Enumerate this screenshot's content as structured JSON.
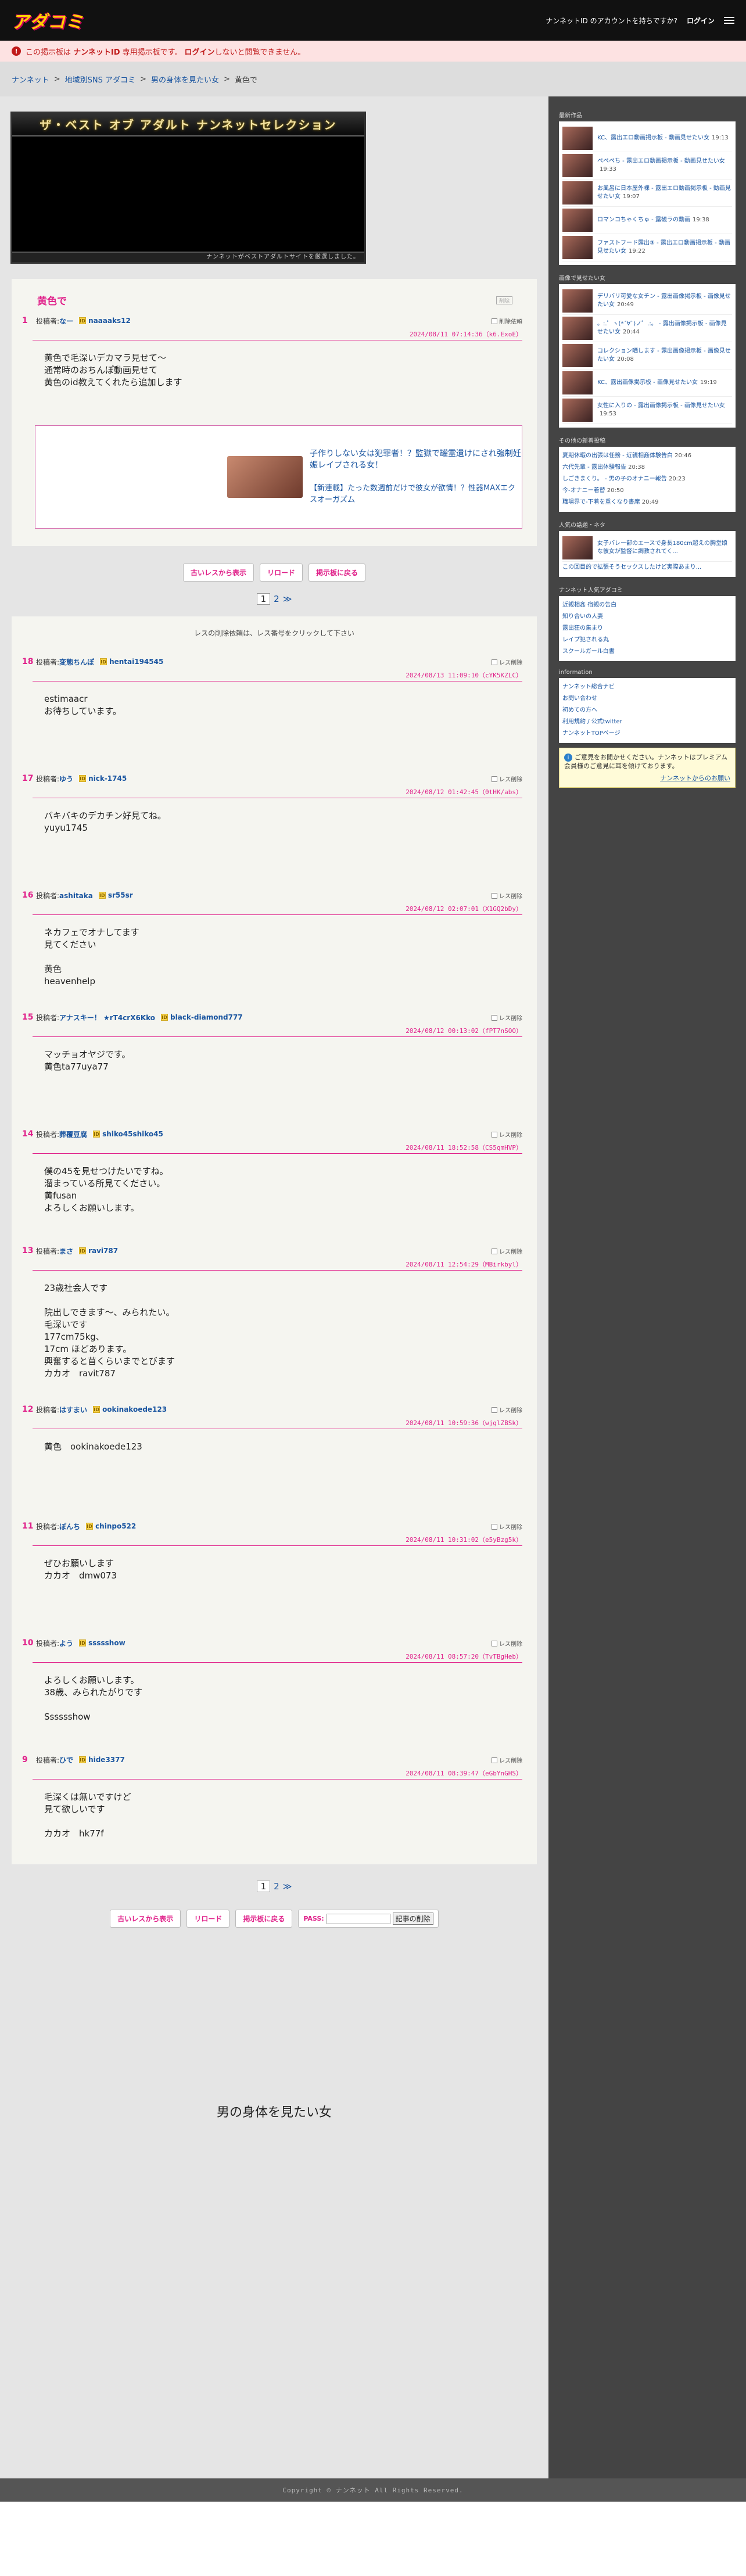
{
  "site": {
    "logo": "アダコミ",
    "no_account": "ナンネットID のアカウントを持ちですか?",
    "login": "ログイン"
  },
  "notice": {
    "icon": "!",
    "text1": "この掲示板は ",
    "id": "ナンネットID",
    "text2": " 専用掲示板です。 ",
    "login": "ログイン",
    "text3": "しないと閲覧できません。"
  },
  "breadcrumb": [
    "ナンネット",
    "地域別SNS アダコミ",
    "男の身体を見たい女",
    "黄色で"
  ],
  "banner": {
    "title": "ザ・ベスト オブ アダルト ナンネットセレクション",
    "footer": "ナンネットがベストアダルトサイトを厳選しました。"
  },
  "op": {
    "title": "黄色で",
    "remove_label": "削除",
    "num": "1",
    "by_label": "投稿者:",
    "name": "なー",
    "id": "naaaaks12",
    "date": "2024/08/11 07:14:36（k6.ExoE）",
    "body": "黄色で毛深いデカマラ見せて〜\n通常時のおちんぽ動画見せて\n黄色のid教えてくれたら追加します",
    "del": "削除依頼"
  },
  "ad": {
    "line1": "子作りしない女は犯罪者！？監獄で罐霊遺けにされ強制妊娠レイプされる女！",
    "line2": "【新連載】たった数週前だけで彼女が欲情！？性器MAXエクスオーガズム"
  },
  "buttons": {
    "old": "古いレスから表示",
    "reload": "リロード",
    "back": "掲示板に戻る",
    "pass": "PASS:",
    "delete": "記事の削除"
  },
  "pager": {
    "cur": "1",
    "next": "2",
    "arrow": "≫"
  },
  "reshint": "レスの削除依頼は、レス番号をクリックして下さい",
  "posts": [
    {
      "num": "18",
      "name": "変態ちんぽ",
      "id": "hentai194545",
      "date": "2024/08/13 11:09:10（cYK5KZLC）",
      "body": "estimaacr\nお待ちしています。"
    },
    {
      "num": "17",
      "name": "ゆう",
      "id": "nick-1745",
      "date": "2024/08/12 01:42:45（0tHK/abs）",
      "body": "バキバキのデカチン好見てね。\nyuyu1745"
    },
    {
      "num": "16",
      "name": "ashitaka",
      "id": "sr55sr",
      "date": "2024/08/12 02:07:01（X1GQ2bDy）",
      "body": "ネカフェでオナしてます\n見てください\n\n黄色\nheavenhelp"
    },
    {
      "num": "15",
      "name": "アナスキー！ ★rT4crX6Kko",
      "id": "black-diamond777",
      "date": "2024/08/12 00:13:02（fPT7nSOO）",
      "body": "マッチョオヤジです。\n黄色ta77uya77"
    },
    {
      "num": "14",
      "name": "葬覆豆腐",
      "id": "shiko45shiko45",
      "date": "2024/08/11 18:52:58（CS5qmHVP）",
      "body": "僕の45を見せつけたいですね。\n溜まっている所見てください。\n黄fusan\nよろしくお願いします。"
    },
    {
      "num": "13",
      "name": "まさ",
      "id": "ravi787",
      "date": "2024/08/11 12:54:29（MBirkbyl）",
      "body": "23歳社会人です\n\n院出しできます〜、みられたい。\n毛深いです\n177cm75kg、\n17cm ほどあります。\n興奮すると苜くらいまでとびます\nカカオ　ravit787"
    },
    {
      "num": "12",
      "name": "はすまい",
      "id": "ookinakoede123",
      "date": "2024/08/11 10:59:36（wjglZBSk）",
      "body": "黄色　ookinakoede123"
    },
    {
      "num": "11",
      "name": "ぽんち",
      "id": "chinpo522",
      "date": "2024/08/11 10:31:02（e5yBzg5k）",
      "body": "ぜひお願いします\nカカオ　dmw073"
    },
    {
      "num": "10",
      "name": "よう",
      "id": "ssssshow",
      "date": "2024/08/11 08:57:20（TvTBgHeb）",
      "body": "よろしくお願いします。\n38歳、みられたがりです\n\nSssssshow"
    },
    {
      "num": "9",
      "name": "ひで",
      "id": "hide3377",
      "date": "2024/08/11 08:39:47（eGbYnGHS）",
      "body": "毛深くは無いですけど\n見て欲しいです\n\nカカオ　hk77f"
    }
  ],
  "post_label": "投稿者:",
  "del_label": "レス削除",
  "pagetitle": "男の身体を見たい女",
  "footer": "Copyright © ナンネット All Rights Reserved.",
  "sidebar": {
    "s1": {
      "title": "最新作品",
      "items": [
        {
          "t": "KC、露出エロ動画掲示板 - 動画見せたい女",
          "tm": "19:13"
        },
        {
          "t": "ペペペち - 露出エロ動画掲示板 - 動画見せたい女",
          "tm": "19:33"
        },
        {
          "t": "お風呂に日本屋外裸 - 露出エロ動画掲示板 - 動画見せたい女",
          "tm": "19:07"
        },
        {
          "t": "ロマンコちゃくちゅ - 露観ラの動画",
          "tm": "19:38"
        },
        {
          "t": "ファストフード露出③ - 露出エロ動画掲示板 - 動画見せたい女",
          "tm": "19:22"
        }
      ]
    },
    "s2": {
      "title": "画像で見せたい女",
      "items": [
        {
          "t": "デリバリ可愛な女チン - 露出画像掲示板 - 画像見せたい女",
          "tm": "20:49"
        },
        {
          "t": "。:.゜ヽ(*´∀`)ノ゜.:。 - 露出画像掲示板 - 画像見せたい女",
          "tm": "20:44"
        },
        {
          "t": "コレクション晒します - 露出画像掲示板 - 画像見せたい女",
          "tm": "20:08"
        },
        {
          "t": "KC、露出画像掲示板 - 画像見せたい女",
          "tm": "19:19"
        },
        {
          "t": "女性に入りの - 露出画像掲示板 - 画像見せたい女",
          "tm": "19:53"
        }
      ]
    },
    "s3": {
      "title": "その他の新着投稿",
      "links": [
        {
          "t": "夏期休暇の出張は任務 - 近親相姦体験告白",
          "tm": "20:46"
        },
        {
          "t": "六代先輩 - 露出体験報告",
          "tm": "20:38"
        },
        {
          "t": "しごきまくり。 - 男の子のオナニー報告",
          "tm": "20:23"
        },
        {
          "t": "今-オナニー着替",
          "tm": "20:50"
        },
        {
          "t": "職場界で-下着を重くなり書席",
          "tm": "20:49"
        }
      ]
    },
    "s4": {
      "title": "人気の話題・ネタ",
      "item": "女子バレー部のエースで身長180cm超えの胸堂娘な彼女が監督に調教されてく...",
      "link": "この回目的で拡張そうセックスしたけど実際あまり..."
    },
    "s5": {
      "title": "ナンネット人気アダコミ",
      "links": [
        "近親相姦 宿親の告白",
        "知り合いの人妻",
        "露出狂の集まり",
        "レイプ犯される丸",
        "スクールガール白書"
      ]
    },
    "s6": {
      "title": "information",
      "links": [
        "ナンネット総合ナビ",
        "お問い合わせ",
        "初めての方へ",
        "利用規約 / 公式twitter",
        "ナンネットTOPページ"
      ]
    },
    "s7": {
      "icon": "i",
      "text": "ご意見をお聞かせください。ナンネットはプレミアム会員様のご意見に耳を傾けております。",
      "more": "ナンネットからのお願い"
    }
  }
}
